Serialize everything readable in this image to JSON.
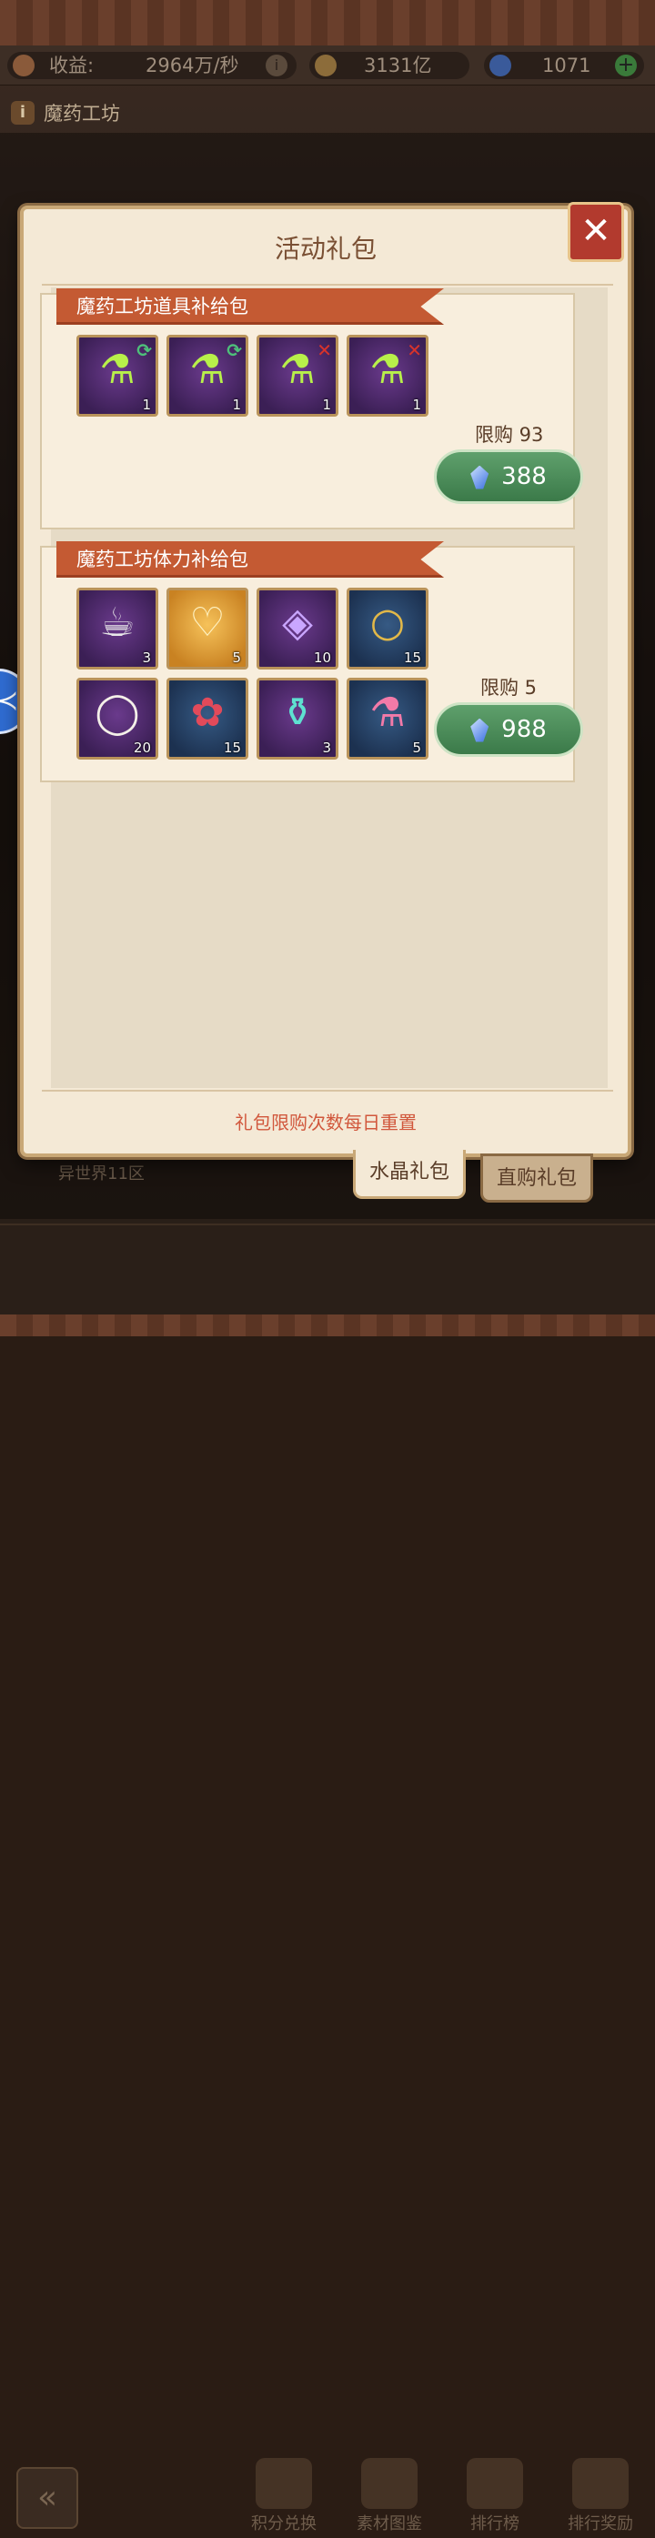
{
  "topbar": {
    "income_label": "收益:",
    "income_value": "2964万/秒",
    "gold_value": "3131亿",
    "crystal_value": "1071"
  },
  "page": {
    "title": "魔药工坊",
    "server": "异世界11区"
  },
  "dialog": {
    "title": "活动礼包",
    "note": "礼包限购次数每日重置",
    "packs": [
      {
        "name": "魔药工坊道具补给包",
        "limit": "限购 93",
        "price": "388",
        "items": [
          {
            "icon": "green-potion-icon",
            "count": "1",
            "mark": "⟳"
          },
          {
            "icon": "green-potion-icon",
            "count": "1",
            "mark": "⟳"
          },
          {
            "icon": "green-potion-icon",
            "count": "1",
            "mark": "✕"
          },
          {
            "icon": "green-potion-icon",
            "count": "1",
            "mark": "✕"
          }
        ]
      },
      {
        "name": "魔药工坊体力补给包",
        "limit": "限购 5",
        "price": "988",
        "items": [
          {
            "icon": "tea-cup-icon",
            "count": "3"
          },
          {
            "icon": "heart-gem-ring-icon",
            "count": "5"
          },
          {
            "icon": "purple-gem-ring-icon",
            "count": "10"
          },
          {
            "icon": "gold-ring-icon",
            "count": "15"
          },
          {
            "icon": "pearl-necklace-icon",
            "count": "20"
          },
          {
            "icon": "flower-wreath-icon",
            "count": "15"
          },
          {
            "icon": "cyan-vial-icon",
            "count": "3"
          },
          {
            "icon": "pink-potion-icon",
            "count": "5"
          }
        ]
      }
    ]
  },
  "tabs": {
    "crystal": "水晶礼包",
    "direct": "直购礼包"
  },
  "nav": {
    "points": "积分兑换",
    "materials": "素材图鉴",
    "ranking": "排行榜",
    "rewards": "排行奖励"
  },
  "colors": {
    "ribbon": "#c45a33",
    "buy_button": "#4a8a58",
    "note": "#d1573c"
  }
}
